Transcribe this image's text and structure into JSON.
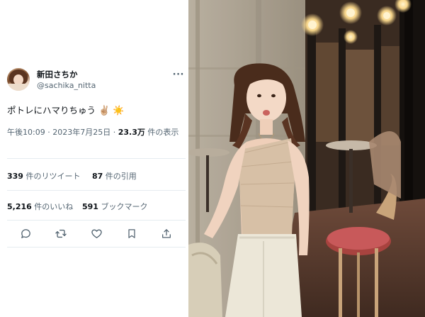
{
  "author": {
    "display_name": "新田さちか",
    "handle": "@sachika_nitta"
  },
  "tweet": {
    "text": "ポトレにハマりちゅう",
    "emoji_1": "✌🏼",
    "emoji_2": "☀️"
  },
  "meta": {
    "time": "午後10:09",
    "separator": " · ",
    "date": "2023年7月25日",
    "views_count": "23.3万",
    "views_label": " 件の表示"
  },
  "stats": {
    "retweets_count": "339",
    "retweets_label": " 件のリツイート",
    "quotes_count": "87",
    "quotes_label": " 件の引用",
    "likes_count": "5,216",
    "likes_label": " 件のいいね",
    "bookmarks_count": "591",
    "bookmarks_label": " ブックマーク"
  },
  "icons": {
    "reply": "reply-icon",
    "retweet": "retweet-icon",
    "like": "heart-icon",
    "bookmark": "bookmark-icon",
    "share": "share-icon",
    "more": "more-icon"
  },
  "colors": {
    "text_primary": "#0f1419",
    "text_secondary": "#536471",
    "divider": "#e6ecf0"
  }
}
